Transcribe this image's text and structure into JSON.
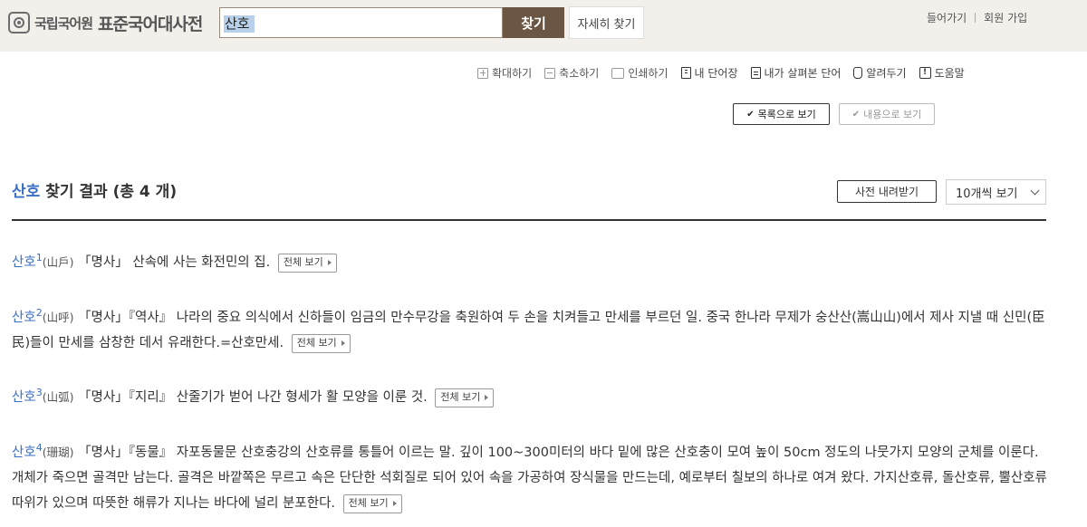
{
  "header": {
    "logo_org": "국립국어원",
    "logo_dict": "표준국어대사전",
    "search_value": "산호",
    "search_button": "찾기",
    "advanced_search": "자세히 찾기",
    "login": "들어가기",
    "signup": "회원 가입"
  },
  "toolbar": {
    "zoom_in": "확대하기",
    "zoom_out": "축소하기",
    "print": "인쇄하기",
    "my_words": "내 단어장",
    "my_viewed": "내가 살펴본 단어",
    "notify": "알려두기",
    "help": "도움말"
  },
  "view": {
    "list": "목록으로 보기",
    "content": "내용으로 보기"
  },
  "results": {
    "keyword": "산호",
    "title_rest": "찾기 결과 (총 4 개)",
    "download": "사전 내려받기",
    "per_page": "10개씩 보기"
  },
  "entries": [
    {
      "word": "산호",
      "num": "1",
      "hanja": "(山戶)",
      "pos": "「명사」",
      "definition": " 산속에 사는 화전민의 집.",
      "more": "전체 보기"
    },
    {
      "word": "산호",
      "num": "2",
      "hanja": "(山呼)",
      "pos": "「명사」『역사』",
      "definition": " 나라의 중요 의식에서 신하들이 임금의 만수무강을 축원하여 두 손을 치켜들고 만세를 부르던 일. 중국 한나라 무제가 숭산산(嵩山山)에서 제사 지낼 때 신민(臣民)들이 만세를 삼창한 데서 유래한다.=산호만세.",
      "more": "전체 보기"
    },
    {
      "word": "산호",
      "num": "3",
      "hanja": "(山弧)",
      "pos": "「명사」『지리』",
      "definition": " 산줄기가 벋어 나간 형세가 활 모양을 이룬 것.",
      "more": "전체 보기"
    },
    {
      "word": "산호",
      "num": "4",
      "hanja": "(珊瑚)",
      "pos": "「명사」『동물』",
      "definition": " 자포동물문 산호충강의 산호류를 통틀어 이르는 말. 깊이 100~300미터의 바다 밑에 많은 산호충이 모여 높이 50cm 정도의 나뭇가지 모양의 군체를 이룬다. 개체가 죽으면 골격만 남는다. 골격은 바깥쪽은 무르고 속은 단단한 석회질로 되어 있어 속을 가공하여 장식물을 만드는데, 예로부터 칠보의 하나로 여겨 왔다. 가지산호류, 돌산호류, 뿔산호류 따위가 있으며 따뜻한 해류가 지나는 바다에 널리 분포한다.",
      "more": "전체 보기"
    }
  ]
}
